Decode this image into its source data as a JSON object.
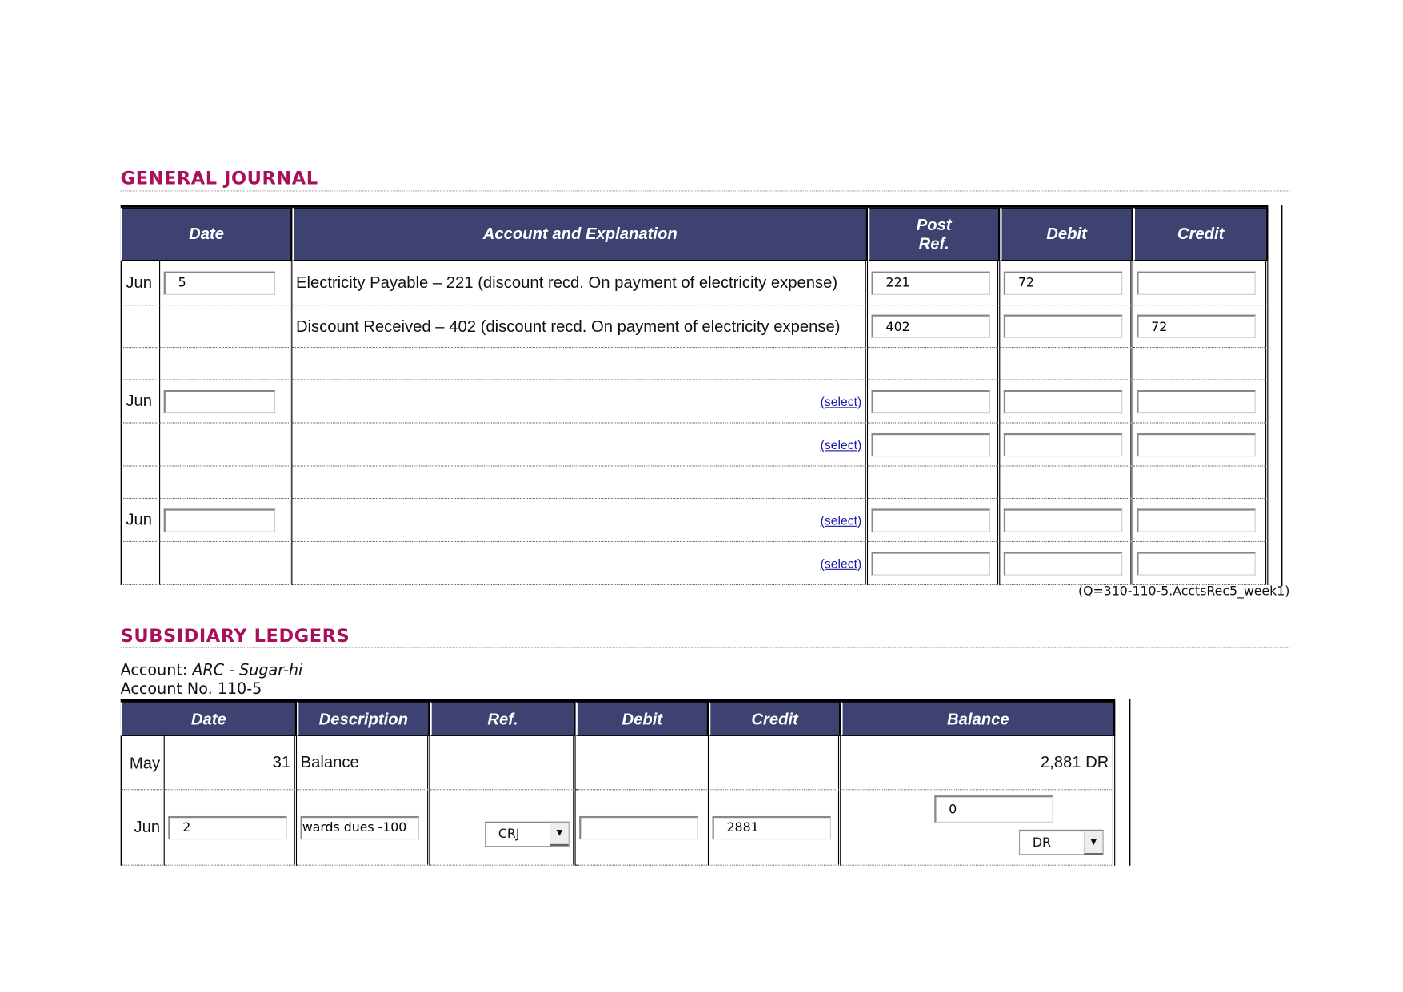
{
  "general_journal": {
    "title": "GENERAL JOURNAL",
    "headers": {
      "date": "Date",
      "account": "Account and Explanation",
      "post_ref": "Post Ref.",
      "debit": "Debit",
      "credit": "Credit"
    },
    "select_label": "(select)",
    "rows": [
      {
        "month": "Jun",
        "day": "5",
        "account": "Electricity Payable – 221 (discount recd. On payment of electricity expense)",
        "post_ref": "221",
        "debit": "72",
        "credit": ""
      },
      {
        "month": "",
        "day": null,
        "account": "Discount Received – 402 (discount recd. On payment of electricity expense)",
        "post_ref": "402",
        "debit": "",
        "credit": "72"
      }
    ],
    "footer_code": "(Q=310-110-5.AcctsRec5_week1)"
  },
  "subsidiary_ledgers": {
    "title": "SUBSIDIARY LEDGERS",
    "account_label": "Account: ",
    "account_name": "ARC - Sugar-hi",
    "account_no": "Account No. 110-5",
    "headers": {
      "date": "Date",
      "description": "Description",
      "ref": "Ref.",
      "debit": "Debit",
      "credit": "Credit",
      "balance": "Balance"
    },
    "rows": [
      {
        "month": "May",
        "day": "31",
        "description": "Balance",
        "balance": "2,881 DR"
      },
      {
        "month": "Jun",
        "day": "2",
        "description": "wards dues -100",
        "ref": "CRJ",
        "debit": "",
        "credit": "2881",
        "balance": "0",
        "balance_type": "DR"
      }
    ]
  }
}
